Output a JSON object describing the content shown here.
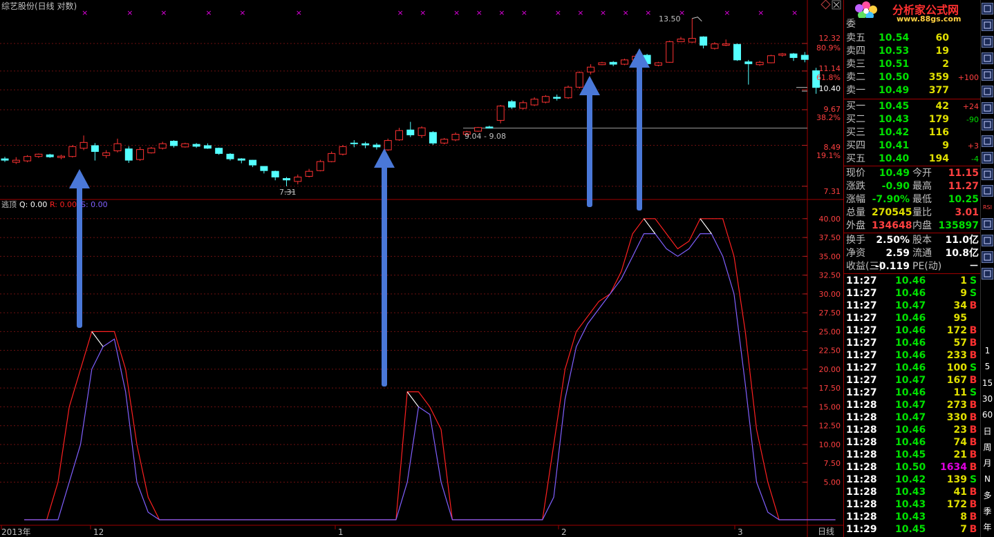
{
  "header": {
    "title": "综艺股份(日线 对数)",
    "indicator_name": "逃顶",
    "indicator_q": "Q: 0.00",
    "indicator_r": "R: 0.00",
    "indicator_s": "S: 0.00"
  },
  "annotations": {
    "high_label": "13.50",
    "low_label": "7.31",
    "range_label": "9.04 - 9.08"
  },
  "price_axis": {
    "labels": [
      {
        "text": "12.32",
        "color": "#ff4040"
      },
      {
        "text": "80.9%",
        "color": "#ff4040"
      },
      {
        "text": "11.14",
        "color": "#ff4040"
      },
      {
        "text": "61.8%",
        "color": "#ff4040"
      },
      {
        "text": "10.40",
        "color": "#ffffff"
      },
      {
        "text": "9.67",
        "color": "#ff4040"
      },
      {
        "text": "38.2%",
        "color": "#ff4040"
      },
      {
        "text": "8.49",
        "color": "#ff4040"
      },
      {
        "text": "19.1%",
        "color": "#ff4040"
      },
      {
        "text": "7.31",
        "color": "#ff4040"
      }
    ]
  },
  "ind_axis": {
    "labels": [
      "40.00",
      "37.50",
      "35.00",
      "32.50",
      "30.00",
      "27.50",
      "25.00",
      "22.50",
      "20.00",
      "17.50",
      "15.00",
      "12.50",
      "10.00",
      "7.50",
      "5.00"
    ]
  },
  "date_axis": {
    "labels": [
      "2013年",
      "12",
      "1",
      "2",
      "3"
    ],
    "period": "日线"
  },
  "logo": {
    "brand": "分析家公式网",
    "url": "www.88gs.com"
  },
  "order_book": {
    "top_label": "委",
    "sells": [
      {
        "label": "卖五",
        "price": "10.54",
        "vol": "60",
        "chg": ""
      },
      {
        "label": "卖四",
        "price": "10.53",
        "vol": "19",
        "chg": ""
      },
      {
        "label": "卖三",
        "price": "10.51",
        "vol": "2",
        "chg": ""
      },
      {
        "label": "卖二",
        "price": "10.50",
        "vol": "359",
        "chg": "+100"
      },
      {
        "label": "卖一",
        "price": "10.49",
        "vol": "377",
        "chg": ""
      }
    ],
    "buys": [
      {
        "label": "买一",
        "price": "10.45",
        "vol": "42",
        "chg": "+24"
      },
      {
        "label": "买二",
        "price": "10.43",
        "vol": "179",
        "chg": "-90"
      },
      {
        "label": "买三",
        "price": "10.42",
        "vol": "116",
        "chg": ""
      },
      {
        "label": "买四",
        "price": "10.41",
        "vol": "9",
        "chg": "+3"
      },
      {
        "label": "买五",
        "price": "10.40",
        "vol": "194",
        "chg": "-4"
      }
    ]
  },
  "quote": {
    "rows": [
      {
        "l1": "现价",
        "v1": "10.49",
        "c1": "#00e000",
        "l2": "今开",
        "v2": "11.15",
        "c2": "#ff4040"
      },
      {
        "l1": "涨跌",
        "v1": "-0.90",
        "c1": "#00e000",
        "l2": "最高",
        "v2": "11.27",
        "c2": "#ff4040"
      },
      {
        "l1": "涨幅",
        "v1": "-7.90%",
        "c1": "#00e000",
        "l2": "最低",
        "v2": "10.25",
        "c2": "#00e000"
      },
      {
        "l1": "总量",
        "v1": "270545",
        "c1": "#e0e000",
        "l2": "量比",
        "v2": "3.01",
        "c2": "#ff4040"
      },
      {
        "l1": "外盘",
        "v1": "134648",
        "c1": "#ff4040",
        "l2": "内盘",
        "v2": "135897",
        "c2": "#00e000"
      }
    ],
    "rows2": [
      {
        "l1": "换手",
        "v1": "2.50%",
        "c1": "#ffffff",
        "l2": "股本",
        "v2": "11.0亿",
        "c2": "#ffffff"
      },
      {
        "l1": "净资",
        "v1": "2.59",
        "c1": "#ffffff",
        "l2": "流通",
        "v2": "10.8亿",
        "c2": "#ffffff"
      },
      {
        "l1": "收益(三)",
        "v1": "-0.119",
        "c1": "#ffffff",
        "l2": "PE(动)",
        "v2": "－",
        "c2": "#ffffff"
      }
    ]
  },
  "ticks": [
    {
      "t": "11:27",
      "p": "10.46",
      "v": "1",
      "s": "S"
    },
    {
      "t": "11:27",
      "p": "10.46",
      "v": "9",
      "s": "S"
    },
    {
      "t": "11:27",
      "p": "10.47",
      "v": "34",
      "s": "B"
    },
    {
      "t": "11:27",
      "p": "10.46",
      "v": "95",
      "s": ""
    },
    {
      "t": "11:27",
      "p": "10.46",
      "v": "172",
      "s": "B"
    },
    {
      "t": "11:27",
      "p": "10.46",
      "v": "57",
      "s": "B"
    },
    {
      "t": "11:27",
      "p": "10.46",
      "v": "233",
      "s": "B"
    },
    {
      "t": "11:27",
      "p": "10.46",
      "v": "100",
      "s": "S"
    },
    {
      "t": "11:27",
      "p": "10.47",
      "v": "167",
      "s": "B"
    },
    {
      "t": "11:27",
      "p": "10.46",
      "v": "11",
      "s": "S"
    },
    {
      "t": "11:28",
      "p": "10.47",
      "v": "273",
      "s": "B"
    },
    {
      "t": "11:28",
      "p": "10.47",
      "v": "330",
      "s": "B"
    },
    {
      "t": "11:28",
      "p": "10.46",
      "v": "23",
      "s": "B"
    },
    {
      "t": "11:28",
      "p": "10.46",
      "v": "74",
      "s": "B"
    },
    {
      "t": "11:28",
      "p": "10.45",
      "v": "21",
      "s": "B"
    },
    {
      "t": "11:28",
      "p": "10.50",
      "v": "1634",
      "s": "B",
      "vcolor": "#e000e0"
    },
    {
      "t": "11:28",
      "p": "10.42",
      "v": "139",
      "s": "S"
    },
    {
      "t": "11:28",
      "p": "10.43",
      "v": "41",
      "s": "B"
    },
    {
      "t": "11:28",
      "p": "10.43",
      "v": "172",
      "s": "B"
    },
    {
      "t": "11:28",
      "p": "10.43",
      "v": "8",
      "s": "B"
    },
    {
      "t": "11:29",
      "p": "10.45",
      "v": "7",
      "s": "B"
    }
  ],
  "toolbar": {
    "icon_items": [
      "restore-icon",
      "list-icon",
      "line-chart-icon",
      "bar-chart-icon",
      "candle-icon",
      "f10-icon",
      "doc-icon",
      "news-icon",
      "f12-icon",
      "f10b-icon",
      "circle-icon",
      "wave-icon",
      "rsi-icon",
      "move-icon",
      "pencil-icon",
      "f5-icon",
      "refresh-icon"
    ],
    "rsi_text": "RSI",
    "period_items": [
      "1",
      "5",
      "15",
      "30",
      "60",
      "日",
      "周",
      "月",
      "N",
      "多",
      "季",
      "年"
    ]
  },
  "chart_data": {
    "type": "candlestick",
    "price_axis": {
      "scale": "log",
      "range": [
        7.0,
        13.8
      ]
    },
    "candles": [
      {
        "o": 8.08,
        "c": 8.04,
        "h": 8.14,
        "l": 7.99
      },
      {
        "o": 7.98,
        "c": 8.04,
        "h": 8.13,
        "l": 7.93
      },
      {
        "o": 8.02,
        "c": 8.15,
        "h": 8.19,
        "l": 7.98
      },
      {
        "o": 8.15,
        "c": 8.22,
        "h": 8.24,
        "l": 8.11
      },
      {
        "o": 8.2,
        "c": 8.14,
        "h": 8.23,
        "l": 8.11
      },
      {
        "o": 8.12,
        "c": 8.16,
        "h": 8.2,
        "l": 8.07
      },
      {
        "o": 8.15,
        "c": 8.45,
        "h": 8.5,
        "l": 8.12
      },
      {
        "o": 8.4,
        "c": 8.58,
        "h": 8.8,
        "l": 8.34
      },
      {
        "o": 8.48,
        "c": 8.3,
        "h": 8.56,
        "l": 8.03
      },
      {
        "o": 8.18,
        "c": 8.26,
        "h": 8.34,
        "l": 8.1
      },
      {
        "o": 8.32,
        "c": 8.54,
        "h": 8.7,
        "l": 8.27
      },
      {
        "o": 8.38,
        "c": 8.04,
        "h": 8.46,
        "l": 7.96
      },
      {
        "o": 8.06,
        "c": 8.36,
        "h": 8.44,
        "l": 8.02
      },
      {
        "o": 8.26,
        "c": 8.4,
        "h": 8.44,
        "l": 8.24
      },
      {
        "o": 8.4,
        "c": 8.54,
        "h": 8.6,
        "l": 8.36
      },
      {
        "o": 8.62,
        "c": 8.48,
        "h": 8.65,
        "l": 8.42
      },
      {
        "o": 8.44,
        "c": 8.54,
        "h": 8.57,
        "l": 8.42
      },
      {
        "o": 8.52,
        "c": 8.46,
        "h": 8.56,
        "l": 8.41
      },
      {
        "o": 8.48,
        "c": 8.4,
        "h": 8.55,
        "l": 8.38
      },
      {
        "o": 8.4,
        "c": 8.24,
        "h": 8.42,
        "l": 8.2
      },
      {
        "o": 8.22,
        "c": 8.08,
        "h": 8.25,
        "l": 8.03
      },
      {
        "o": 8.08,
        "c": 8.04,
        "h": 8.1,
        "l": 7.95
      },
      {
        "o": 8.04,
        "c": 7.9,
        "h": 8.05,
        "l": 7.84
      },
      {
        "o": 7.86,
        "c": 7.74,
        "h": 7.86,
        "l": 7.66
      },
      {
        "o": 7.72,
        "c": 7.56,
        "h": 7.74,
        "l": 7.47
      },
      {
        "o": 7.52,
        "c": 7.48,
        "h": 7.56,
        "l": 7.31
      },
      {
        "o": 7.44,
        "c": 7.56,
        "h": 7.63,
        "l": 7.36
      },
      {
        "o": 7.58,
        "c": 7.72,
        "h": 7.79,
        "l": 7.55
      },
      {
        "o": 7.74,
        "c": 8.0,
        "h": 8.05,
        "l": 7.72
      },
      {
        "o": 8.0,
        "c": 8.24,
        "h": 8.3,
        "l": 7.98
      },
      {
        "o": 8.22,
        "c": 8.45,
        "h": 8.5,
        "l": 8.18
      },
      {
        "o": 8.56,
        "c": 8.54,
        "h": 8.65,
        "l": 8.43
      },
      {
        "o": 8.54,
        "c": 8.5,
        "h": 8.6,
        "l": 8.4
      },
      {
        "o": 8.5,
        "c": 8.44,
        "h": 8.56,
        "l": 8.36
      },
      {
        "o": 8.35,
        "c": 8.64,
        "h": 8.7,
        "l": 8.32
      },
      {
        "o": 8.66,
        "c": 8.96,
        "h": 9.05,
        "l": 8.63
      },
      {
        "o": 8.98,
        "c": 8.82,
        "h": 9.25,
        "l": 8.75
      },
      {
        "o": 8.8,
        "c": 9.05,
        "h": 9.1,
        "l": 8.72
      },
      {
        "o": 8.9,
        "c": 8.56,
        "h": 8.94,
        "l": 8.5
      },
      {
        "o": 8.56,
        "c": 8.68,
        "h": 8.72,
        "l": 8.52
      },
      {
        "o": 8.66,
        "c": 8.84,
        "h": 8.9,
        "l": 8.62
      },
      {
        "o": 8.84,
        "c": 8.92,
        "h": 8.95,
        "l": 8.8
      },
      {
        "o": 8.94,
        "c": 9.06,
        "h": 9.08,
        "l": 8.92
      },
      {
        "o": 9.08,
        "c": 9.04,
        "h": 9.12,
        "l": 9.04
      },
      {
        "o": 9.3,
        "c": 9.8,
        "h": 9.84,
        "l": 9.2
      },
      {
        "o": 9.96,
        "c": 9.76,
        "h": 10.02,
        "l": 9.7
      },
      {
        "o": 9.72,
        "c": 9.92,
        "h": 10.0,
        "l": 9.68
      },
      {
        "o": 9.84,
        "c": 10.05,
        "h": 10.12,
        "l": 9.8
      },
      {
        "o": 9.94,
        "c": 10.15,
        "h": 10.2,
        "l": 9.9
      },
      {
        "o": 10.12,
        "c": 10.08,
        "h": 10.22,
        "l": 10.0
      },
      {
        "o": 10.1,
        "c": 10.5,
        "h": 10.56,
        "l": 10.06
      },
      {
        "o": 10.5,
        "c": 11.08,
        "h": 11.12,
        "l": 10.45
      },
      {
        "o": 11.1,
        "c": 11.3,
        "h": 11.42,
        "l": 11.0
      },
      {
        "o": 11.4,
        "c": 11.48,
        "h": 11.52,
        "l": 11.38
      },
      {
        "o": 11.5,
        "c": 11.42,
        "h": 11.55,
        "l": 11.34
      },
      {
        "o": 11.42,
        "c": 11.6,
        "h": 11.65,
        "l": 11.38
      },
      {
        "o": 11.6,
        "c": 11.76,
        "h": 11.84,
        "l": 11.55
      },
      {
        "o": 11.8,
        "c": 11.44,
        "h": 11.86,
        "l": 11.4
      },
      {
        "o": 11.38,
        "c": 11.48,
        "h": 11.52,
        "l": 11.33
      },
      {
        "o": 11.5,
        "c": 12.4,
        "h": 12.45,
        "l": 11.48
      },
      {
        "o": 12.4,
        "c": 12.52,
        "h": 12.62,
        "l": 12.4
      },
      {
        "o": 12.38,
        "c": 12.55,
        "h": 13.5,
        "l": 12.35
      },
      {
        "o": 12.62,
        "c": 12.24,
        "h": 12.65,
        "l": 12.1
      },
      {
        "o": 12.1,
        "c": 12.3,
        "h": 12.38,
        "l": 12.05
      },
      {
        "o": 12.24,
        "c": 12.3,
        "h": 12.5,
        "l": 12.2
      },
      {
        "o": 12.28,
        "c": 11.6,
        "h": 12.32,
        "l": 11.56
      },
      {
        "o": 11.52,
        "c": 11.44,
        "h": 11.6,
        "l": 10.6
      },
      {
        "o": 11.4,
        "c": 11.5,
        "h": 11.56,
        "l": 11.35
      },
      {
        "o": 11.48,
        "c": 11.78,
        "h": 11.82,
        "l": 11.46
      },
      {
        "o": 11.8,
        "c": 11.86,
        "h": 11.9,
        "l": 11.74
      },
      {
        "o": 11.86,
        "c": 11.7,
        "h": 11.9,
        "l": 11.56
      },
      {
        "o": 11.8,
        "c": 11.62,
        "h": 11.94,
        "l": 11.5
      },
      {
        "o": 11.15,
        "c": 10.49,
        "h": 11.27,
        "l": 10.25
      }
    ],
    "indicator": {
      "name": "逃顶",
      "axis_range": [
        0,
        42
      ],
      "series": [
        {
          "name": "R",
          "color": "#ff2020",
          "values": [
            0,
            0,
            0,
            5,
            15,
            20,
            25,
            25,
            25,
            20,
            10,
            3,
            0,
            0,
            0,
            0,
            0,
            0,
            0,
            0,
            0,
            0,
            0,
            0,
            0,
            0,
            0,
            0,
            0,
            0,
            0,
            0,
            0,
            0,
            17,
            17,
            15,
            12,
            0,
            0,
            0,
            0,
            0,
            0,
            0,
            0,
            0,
            10,
            20,
            25,
            27,
            29,
            30,
            33,
            38,
            40,
            40,
            38,
            36,
            37,
            40,
            40,
            40,
            35,
            25,
            12,
            5,
            0,
            0,
            0,
            0,
            0,
            0
          ]
        },
        {
          "name": "S",
          "color": "#8060ff",
          "values": [
            0,
            0,
            0,
            0,
            5,
            10,
            20,
            23,
            24,
            17,
            5,
            1,
            0,
            0,
            0,
            0,
            0,
            0,
            0,
            0,
            0,
            0,
            0,
            0,
            0,
            0,
            0,
            0,
            0,
            0,
            0,
            0,
            0,
            0,
            5,
            15,
            14,
            5,
            0,
            0,
            0,
            0,
            0,
            0,
            0,
            0,
            0,
            3,
            16,
            23,
            26,
            28,
            30,
            32,
            35,
            38,
            38,
            36,
            35,
            36,
            38,
            38,
            35,
            30,
            18,
            5,
            1,
            0,
            0,
            0,
            0,
            0,
            0
          ]
        },
        {
          "name": "Q",
          "color": "#ffffff",
          "values": [
            0,
            0,
            0,
            0,
            0,
            0,
            25,
            25,
            0,
            0,
            0,
            0,
            0,
            0,
            0,
            0,
            0,
            0,
            0,
            0,
            0,
            0,
            0,
            0,
            0,
            0,
            0,
            0,
            0,
            0,
            0,
            0,
            0,
            0,
            17,
            15,
            0,
            0,
            0,
            0,
            0,
            0,
            0,
            0,
            0,
            0,
            0,
            0,
            0,
            0,
            0,
            0,
            0,
            0,
            0,
            40,
            40,
            0,
            0,
            0,
            40,
            36,
            0,
            0,
            0,
            0,
            0,
            0,
            0,
            0,
            0,
            0,
            0
          ]
        }
      ]
    },
    "markers": {
      "symbol": "×",
      "color": "#e000e0",
      "indices": [
        7,
        11,
        14,
        18,
        21,
        26,
        35,
        37,
        40,
        42,
        44,
        46,
        49,
        51,
        53,
        55,
        57,
        60,
        64,
        67,
        70
      ]
    },
    "arrows": {
      "color": "#4a78d8",
      "indices": [
        7,
        34,
        52,
        57
      ]
    }
  }
}
